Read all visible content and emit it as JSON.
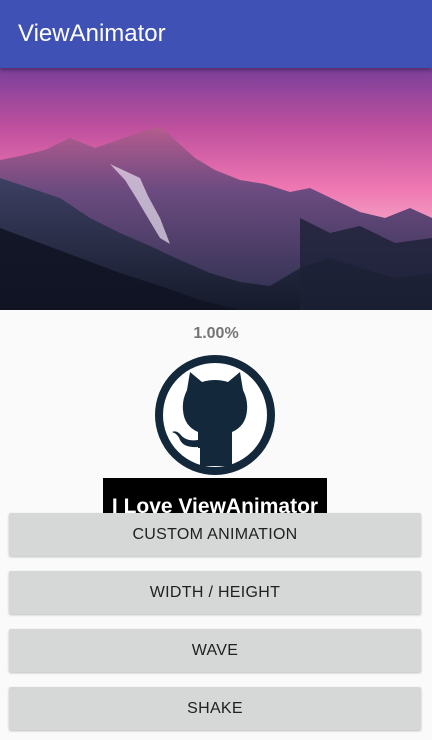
{
  "app_bar": {
    "title": "ViewAnimator"
  },
  "hero": {
    "image": "mountain-landscape-image"
  },
  "status": {
    "progress_text": "1.00%"
  },
  "logo": {
    "icon": "github-octocat-icon"
  },
  "label": {
    "text": "I Love ViewAnimator"
  },
  "buttons": {
    "custom_animation": "CUSTOM ANIMATION",
    "width_height": "WIDTH / HEIGHT",
    "wave": "WAVE",
    "shake": "SHAKE"
  },
  "colors": {
    "primary": "#3f51b5",
    "button_bg": "#d6d7d7",
    "label_bg": "#000000",
    "octocat": "#13283b"
  }
}
